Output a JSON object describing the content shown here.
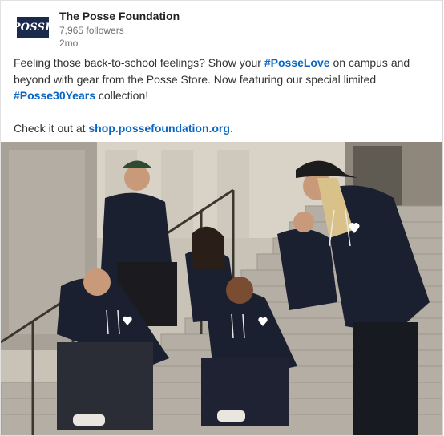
{
  "post": {
    "author": {
      "logo_text": "POSSE",
      "name": "The Posse Foundation",
      "followers": "7,965 followers",
      "time": "2mo"
    },
    "text": {
      "line1_a": "Feeling those back-to-school feelings? Show your ",
      "hashtag1": "#PosseLove",
      "line1_b": " on campus and beyond with gear from the Posse Store. Now featuring our special limited ",
      "hashtag2": "#Posse30Years",
      "line1_c": " collection!",
      "line2_a": "Check it out at ",
      "link": "shop.possefoundation.org",
      "line2_b": "."
    },
    "image": {
      "subject": "group-photo-on-steps"
    }
  },
  "colors": {
    "link": "#0a66c2",
    "logo_bg": "#1a2a4d",
    "hoodie": "#1b2030"
  }
}
